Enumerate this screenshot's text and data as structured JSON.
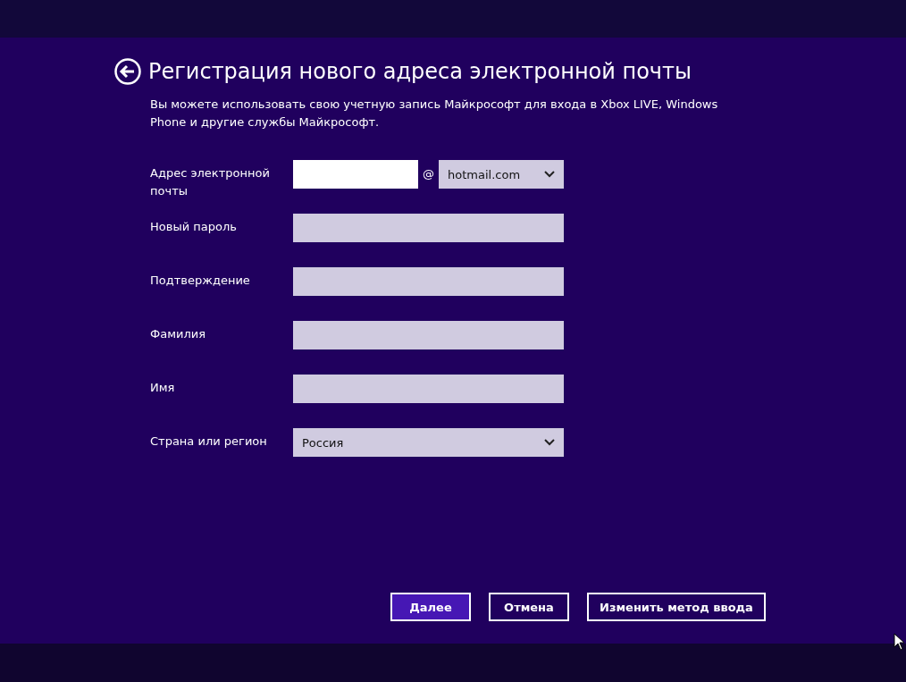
{
  "title": "Регистрация нового адреса электронной почты",
  "description": "Вы можете использовать свою учетную запись Майкрософт для входа в Xbox LIVE, Windows Phone и другие службы Майкрософт.",
  "fields": [
    {
      "kind": "email",
      "label": "Адрес электронной почты",
      "focused": true,
      "at": "@",
      "domain": "hotmail.com"
    },
    {
      "kind": "text",
      "label": "Новый пароль",
      "focused": false
    },
    {
      "kind": "text",
      "label": "Подтверждение",
      "focused": false
    },
    {
      "kind": "text",
      "label": "Фамилия",
      "focused": false
    },
    {
      "kind": "text",
      "label": "Имя",
      "focused": false
    },
    {
      "kind": "select",
      "label": "Страна или регион",
      "focused": false,
      "value": "Россия"
    }
  ],
  "buttons": [
    {
      "label": "Далее",
      "default": true
    },
    {
      "label": "Отмена",
      "default": false
    },
    {
      "label": "Изменить метод ввода",
      "default": false
    }
  ]
}
